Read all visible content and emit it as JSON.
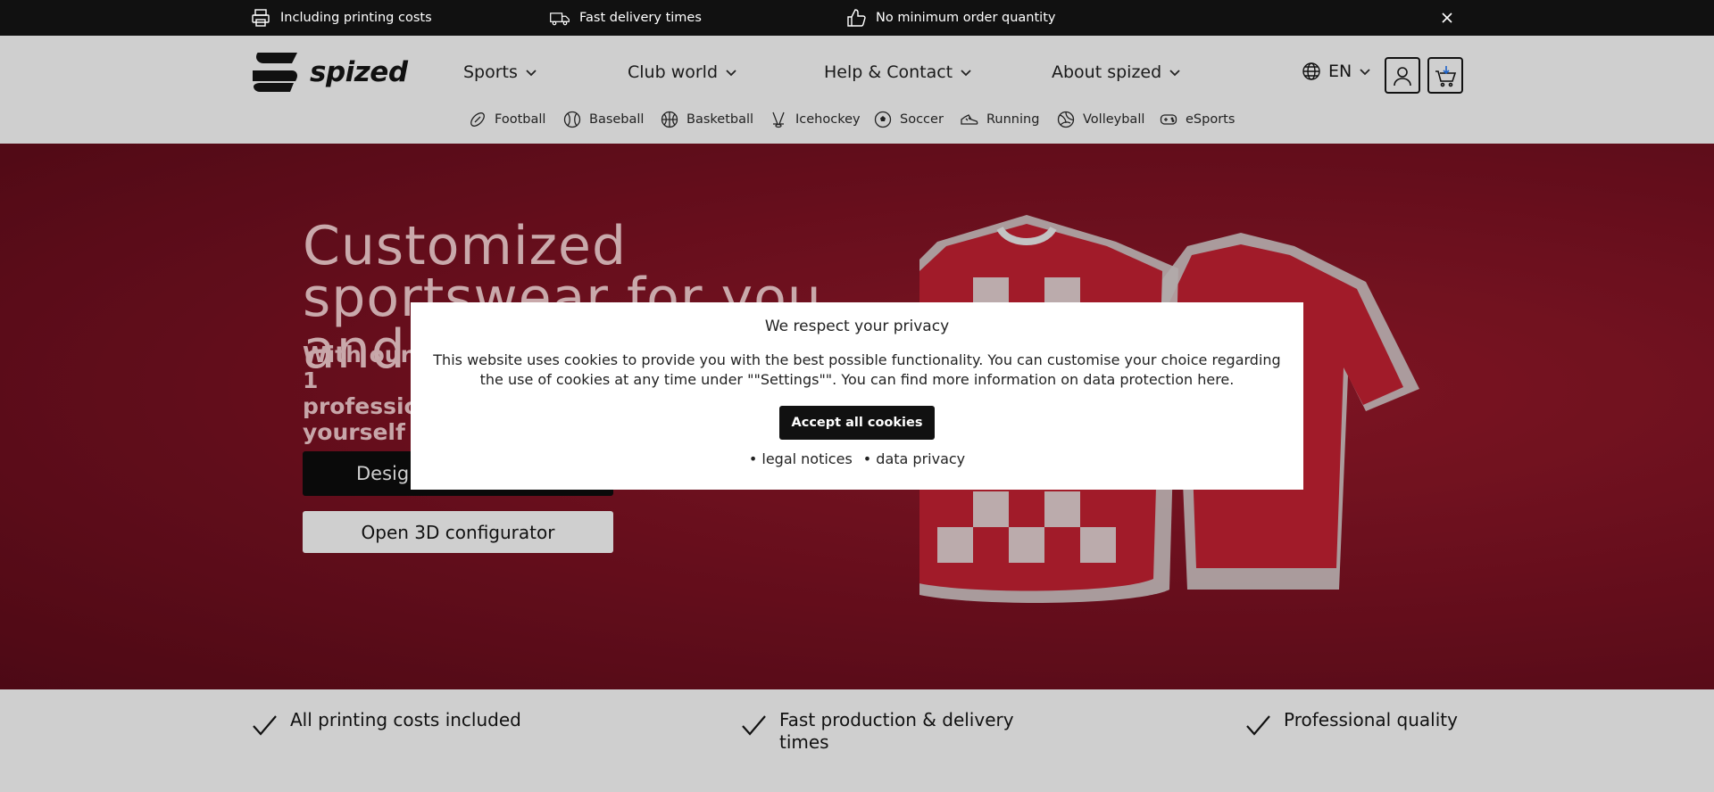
{
  "topbar": {
    "usps": [
      {
        "icon": "printer-icon",
        "label": "Including printing costs"
      },
      {
        "icon": "delivery-truck-icon",
        "label": "Fast delivery times"
      },
      {
        "icon": "thumbs-up-icon",
        "label": "No minimum order quantity"
      }
    ]
  },
  "header": {
    "logo_text": "spized",
    "nav": [
      {
        "label": "Sports"
      },
      {
        "label": "Club world"
      },
      {
        "label": "Help & Contact"
      },
      {
        "label": "About spized"
      }
    ],
    "language": "EN",
    "sports": [
      {
        "icon": "football-icon",
        "label": "Football"
      },
      {
        "icon": "baseball-icon",
        "label": "Baseball"
      },
      {
        "icon": "basketball-icon",
        "label": "Basketball"
      },
      {
        "icon": "icehockey-icon",
        "label": "Icehockey"
      },
      {
        "icon": "soccer-icon",
        "label": "Soccer"
      },
      {
        "icon": "running-icon",
        "label": "Running"
      },
      {
        "icon": "volleyball-icon",
        "label": "Volleyball"
      },
      {
        "icon": "esports-icon",
        "label": "eSports"
      }
    ]
  },
  "hero": {
    "title": "Customized sportswear for you and your team",
    "subtitle": "With our 1 profession yourself o",
    "design_button": "Design",
    "configurator_button": "Open 3D configurator"
  },
  "usps": [
    {
      "label": "All printing costs included"
    },
    {
      "label": "Fast production & delivery times"
    },
    {
      "label": "Professional quality"
    }
  ],
  "modal": {
    "title": "We respect your privacy",
    "text": "This website uses cookies to provide you with the best possible functionality. You can customise your choice regarding the use of cookies at any time under \"\"Settings\"\". You can find more information on data protection here.",
    "accept_label": "Accept all cookies",
    "legal_link": "• legal notices",
    "privacy_link": "• data privacy"
  },
  "colors": {
    "hero_red": "#7a1122",
    "topbar_bg": "#111111",
    "header_bg": "#cfcfcf"
  }
}
